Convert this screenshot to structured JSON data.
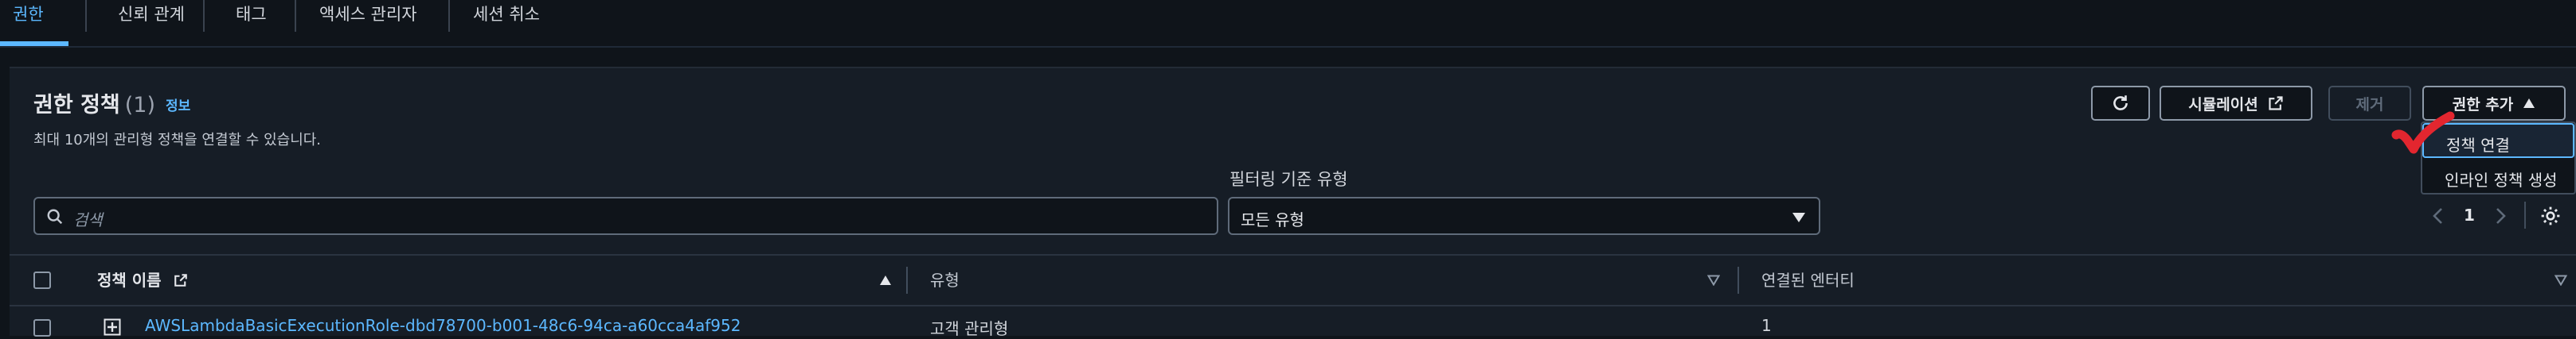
{
  "tabs": [
    {
      "label": "권한",
      "active": true
    },
    {
      "label": "신뢰 관계",
      "active": false
    },
    {
      "label": "태그",
      "active": false
    },
    {
      "label": "액세스 관리자",
      "active": false
    },
    {
      "label": "세션 취소",
      "active": false
    }
  ],
  "panel": {
    "title": "권한 정책",
    "count": "(1)",
    "info_link": "정보",
    "subtitle": "최대 10개의 관리형 정책을 연결할 수 있습니다."
  },
  "toolbar": {
    "simulation_label": "시뮬레이션",
    "remove_label": "제거",
    "add_permission_label": "권한 추가"
  },
  "add_menu": {
    "items": [
      "정책 연결",
      "인라인 정책 생성"
    ]
  },
  "filter": {
    "search_placeholder": "검색",
    "type_label": "필터링 기준 유형",
    "type_value": "모든 유형"
  },
  "pagination": {
    "current_page": "1"
  },
  "table": {
    "headers": {
      "policy_name": "정책 이름",
      "type": "유형",
      "attached_entities": "연결된 엔터티"
    },
    "rows": [
      {
        "policy_name": "AWSLambdaBasicExecutionRole-dbd78700-b001-48c6-94ca-a60cca4af952",
        "type": "고객 관리형",
        "attached_entities": "1"
      }
    ]
  },
  "colors": {
    "accent": "#5cb8ff",
    "background": "#0f141a",
    "panel": "#161d26",
    "annotation_check": "#e3262f"
  },
  "icons": [
    "search-icon",
    "refresh-icon",
    "external-link-icon",
    "caret-up-icon",
    "caret-down-icon",
    "sort-icon",
    "expand-icon",
    "chevron-left-icon",
    "chevron-right-icon",
    "gear-icon",
    "check-mark-icon"
  ]
}
